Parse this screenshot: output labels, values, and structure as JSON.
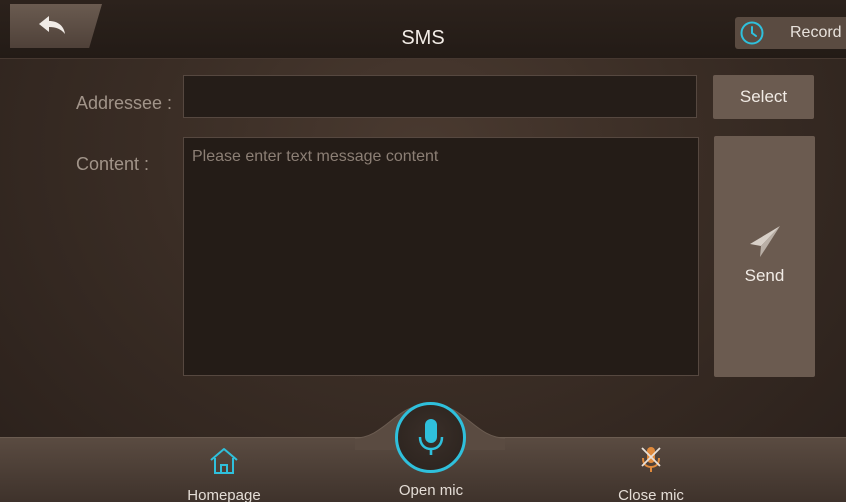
{
  "header": {
    "title": "SMS",
    "record_label": "Record"
  },
  "form": {
    "addressee_label": "Addressee :",
    "addressee_value": "",
    "content_label": "Content :",
    "content_placeholder": "Please enter text message content",
    "select_label": "Select",
    "send_label": "Send"
  },
  "bottom_nav": {
    "homepage_label": "Homepage",
    "open_mic_label": "Open mic",
    "close_mic_label": "Close mic"
  },
  "colors": {
    "accent": "#2fc0dc",
    "mute_icon": "#e08a3c",
    "button_bg": "#6b5b50"
  }
}
